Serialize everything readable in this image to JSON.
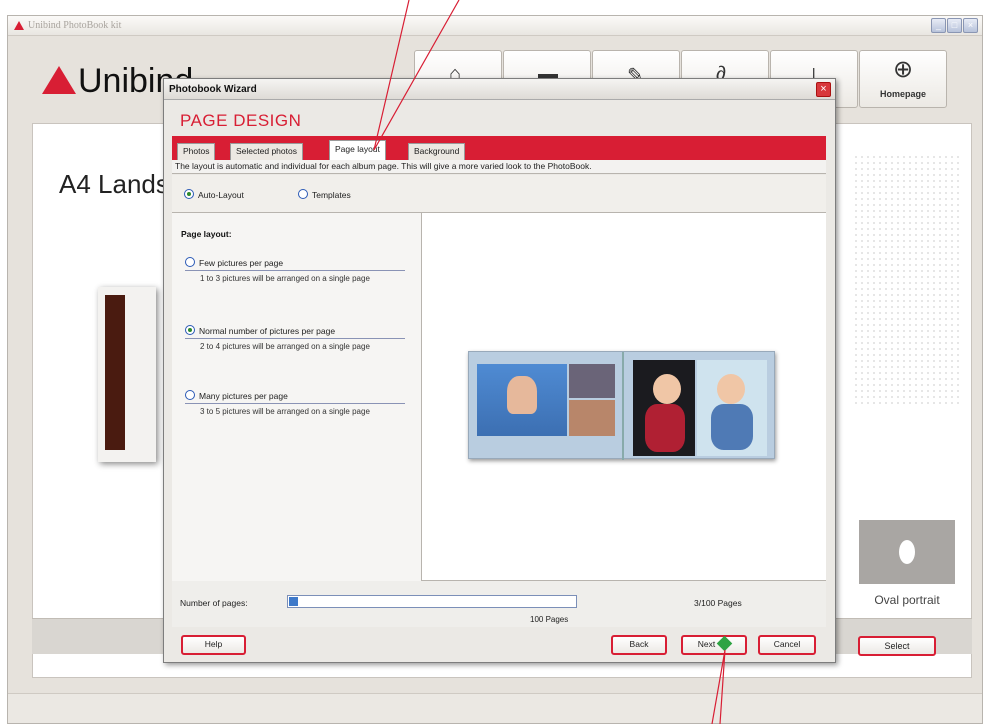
{
  "app": {
    "title": "Unibind PhotoBook kit",
    "logo_text": "Unibi",
    "logo_suffix": "nd",
    "homepage_label": "Homepage",
    "bg_title": "A4 Landscape",
    "oval_label": "Oval portrait",
    "select_label": "Select"
  },
  "toolbar": {
    "icons": [
      "home-icon",
      "folder-icon",
      "tools-icon",
      "draw-icon",
      "upload-icon",
      "globe-icon"
    ]
  },
  "dialog": {
    "title": "Photobook Wizard",
    "heading": "PAGE DESIGN",
    "tabs": [
      "Photos",
      "Selected photos",
      "Page layout",
      "Background"
    ],
    "active_tab": "Page layout",
    "description": "The layout is automatic and individual for each album page. This will give a more varied look to the PhotoBook.",
    "modes": {
      "auto": "Auto-Layout",
      "templates": "Templates",
      "selected": "Auto-Layout"
    },
    "layout_title": "Page layout:",
    "layout_options": [
      {
        "label": "Few pictures per page",
        "sub": "1 to 3 pictures will be arranged on a single page",
        "checked": false
      },
      {
        "label": "Normal number of pictures per page",
        "sub": "2 to 4 pictures will be arranged on a single page",
        "checked": true
      },
      {
        "label": "Many pictures per page",
        "sub": "3 to 5 pictures will be arranged on a single page",
        "checked": false
      }
    ],
    "pages": {
      "label": "Number of pages:",
      "max_label": "100 Pages",
      "count": "3/100 Pages",
      "value": 3,
      "max": 100
    },
    "buttons": {
      "help": "Help",
      "back": "Back",
      "next": "Next",
      "cancel": "Cancel"
    }
  },
  "colors": {
    "accent": "#d81e34",
    "progress": "#3e79c9",
    "next_arrow": "#2ea343"
  }
}
